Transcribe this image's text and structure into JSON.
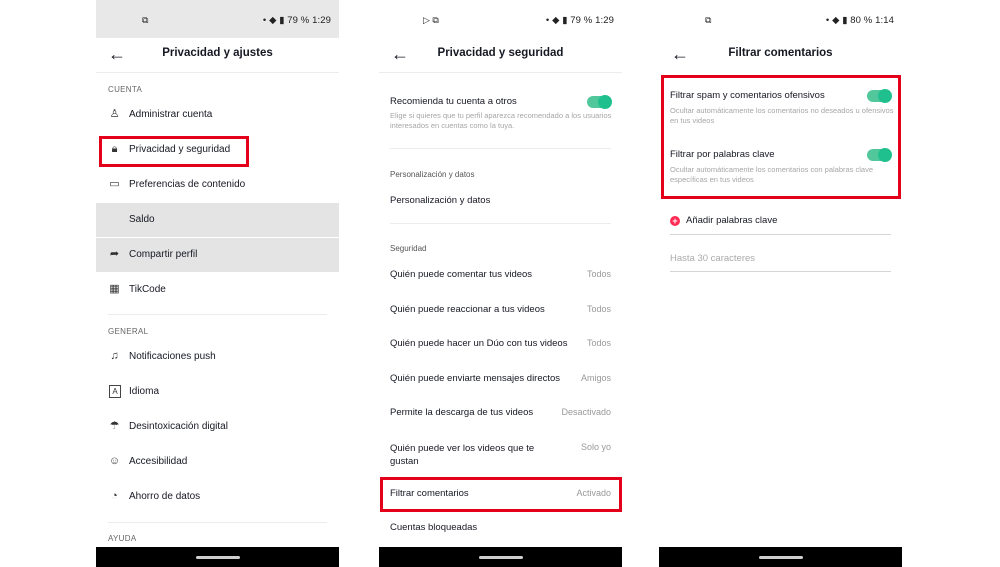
{
  "screen1": {
    "status": {
      "left_icon": "screenshot-icon",
      "battery": "79 %",
      "time": "1:29"
    },
    "title": "Privacidad y ajustes",
    "section_cuenta": "CUENTA",
    "items_cuenta": [
      {
        "label": "Administrar cuenta",
        "icon": "person-icon"
      },
      {
        "label": "Privacidad y seguridad",
        "icon": "lock-icon"
      },
      {
        "label": "Preferencias de contenido",
        "icon": "video-icon"
      },
      {
        "label": "Saldo",
        "icon": "wallet-icon"
      },
      {
        "label": "Compartir perfil",
        "icon": "share-icon"
      },
      {
        "label": "TikCode",
        "icon": "qr-code-icon"
      }
    ],
    "section_general": "GENERAL",
    "items_general": [
      {
        "label": "Notificaciones push",
        "icon": "bell-icon"
      },
      {
        "label": "Idioma",
        "icon": "language-icon"
      },
      {
        "label": "Desintoxicación digital",
        "icon": "umbrella-icon"
      },
      {
        "label": "Accesibilidad",
        "icon": "accessibility-icon"
      },
      {
        "label": "Ahorro de datos",
        "icon": "data-saver-icon"
      }
    ],
    "section_ayuda": "AYUDA"
  },
  "screen2": {
    "status": {
      "battery": "79 %",
      "time": "1:29"
    },
    "title": "Privacidad y seguridad",
    "recommend": {
      "label": "Recomienda tu cuenta a otros",
      "desc": "Elige si quieres que tu perfil aparezca recomendado a los usuarios interesados en cuentas como la tuya.",
      "on": true
    },
    "section_personalizacion": "Personalización y datos",
    "personalizacion_item": "Personalización y datos",
    "section_seguridad": "Seguridad",
    "items": [
      {
        "label": "Quién puede comentar tus videos",
        "value": "Todos"
      },
      {
        "label": "Quién puede reaccionar a tus videos",
        "value": "Todos"
      },
      {
        "label": "Quién puede hacer un Dúo con tus videos",
        "value": "Todos"
      },
      {
        "label": "Quién puede enviarte mensajes directos",
        "value": "Amigos"
      },
      {
        "label": "Permite la descarga de tus videos",
        "value": "Desactivado"
      },
      {
        "label": "Quién puede ver los videos que te gustan",
        "value": "Solo yo"
      },
      {
        "label": "Filtrar comentarios",
        "value": "Activado"
      },
      {
        "label": "Cuentas bloqueadas",
        "value": ""
      }
    ]
  },
  "screen3": {
    "status": {
      "battery": "80 %",
      "time": "1:14"
    },
    "title": "Filtrar comentarios",
    "spam": {
      "label": "Filtrar spam y comentarios ofensivos",
      "desc": "Ocultar automáticamente los comentarios no deseados u ofensivos en tus videos",
      "on": true
    },
    "keywords": {
      "label": "Filtrar por palabras clave",
      "desc": "Ocultar automáticamente los comentarios con palabras clave específicas en tus videos",
      "on": true
    },
    "add_keywords": "Añadir palabras clave",
    "input_placeholder": "Hasta 30 caracteres"
  }
}
